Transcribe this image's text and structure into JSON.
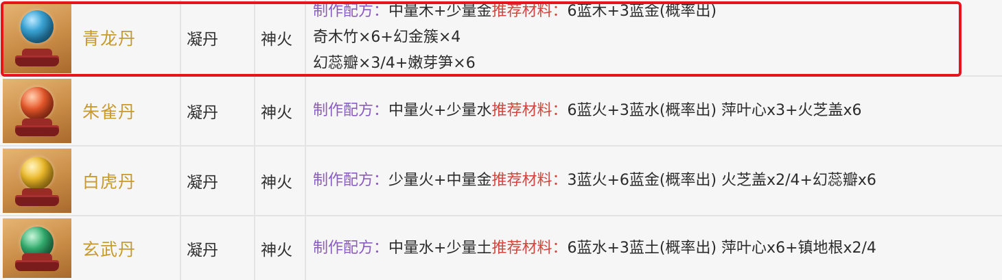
{
  "rows": [
    {
      "name": "青龙丹",
      "type": "凝丹",
      "fire": "神火",
      "orb_color": "#1f8fc4",
      "icon": "blue-dragon-pill-icon",
      "formula_label": "制作配方：",
      "formula": "中量木+少量金",
      "material_label": "推荐材料：",
      "materials": "6蓝木+3蓝金(概率出)",
      "materials_line2": "奇木竹×6+幻金簇×4",
      "materials_line3": "幻蕊瓣×3/4+嫩芽笋×6",
      "highlighted": true
    },
    {
      "name": "朱雀丹",
      "type": "凝丹",
      "fire": "神火",
      "orb_color": "#e0502a",
      "icon": "vermilion-bird-pill-icon",
      "formula_label": "制作配方：",
      "formula": "中量火+少量水",
      "material_label": "推荐材料：",
      "materials": "6蓝火+3蓝水(概率出) 萍叶心x3+火芝盖x6"
    },
    {
      "name": "白虎丹",
      "type": "凝丹",
      "fire": "神火",
      "orb_color": "#e8b21e",
      "icon": "white-tiger-pill-icon",
      "formula_label": "制作配方：",
      "formula": "少量火+中量金",
      "material_label": "推荐材料：",
      "materials": "3蓝火+6蓝金(概率出) 火芝盖x2/4+幻蕊瓣x6"
    },
    {
      "name": "玄武丹",
      "type": "凝丹",
      "fire": "神火",
      "orb_color": "#2fa86a",
      "icon": "black-tortoise-pill-icon",
      "formula_label": "制作配方：",
      "formula": "中量水+少量土",
      "material_label": "推荐材料：",
      "materials": "6蓝水+3蓝土(概率出) 萍叶心x6+镇地根x2/4"
    }
  ]
}
